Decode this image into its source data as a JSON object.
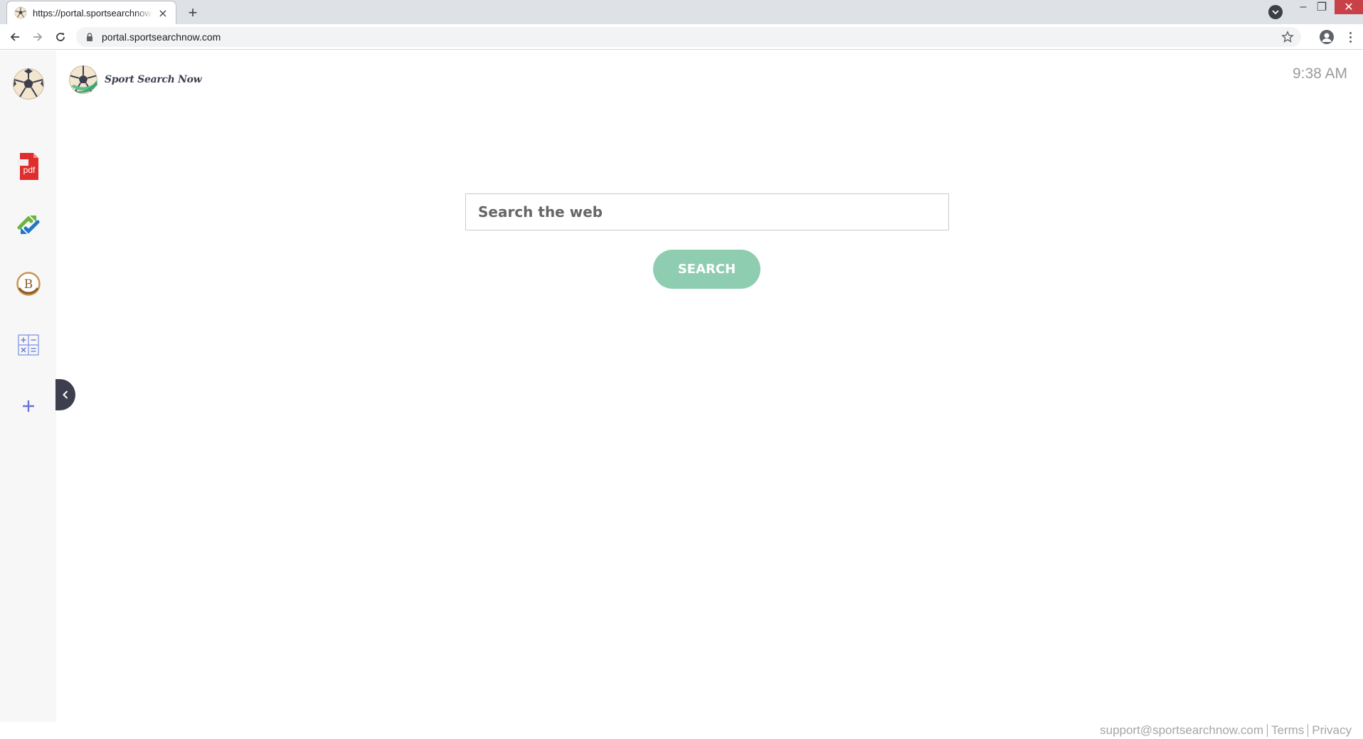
{
  "browser": {
    "tab": {
      "title": "https://portal.sportsearchnow.com",
      "close_glyph": "×"
    },
    "new_tab_glyph": "+",
    "url": "portal.sportsearchnow.com",
    "window": {
      "minimize_glyph": "–",
      "maximize_glyph": "❐",
      "close_glyph": "✕"
    }
  },
  "page": {
    "brand": {
      "name": "Sport Search Now",
      "logo_icon": "soccer-ball-icon"
    },
    "clock": "9:38 AM",
    "search": {
      "placeholder": "Search the web",
      "button_label": "SEARCH"
    },
    "sidebar": {
      "items": [
        {
          "name": "soccer-ball-icon"
        },
        {
          "name": "pdf-icon",
          "label": "pdf"
        },
        {
          "name": "converter-icon"
        },
        {
          "name": "bitcoin-icon",
          "label": "B"
        },
        {
          "name": "calculator-icon"
        },
        {
          "name": "add-icon"
        }
      ],
      "collapse_icon": "chevron-left-icon"
    },
    "footer": {
      "email": "support@sportsearchnow.com",
      "terms": "Terms",
      "privacy": "Privacy"
    }
  },
  "colors": {
    "accent_green": "#8ecdb0",
    "dark_navy": "#3d3f4f",
    "pdf_red": "#e02d2d",
    "calc_blue": "#5b6fd6",
    "bitcoin_brown": "#8a5a2b",
    "window_close_red": "#c94148"
  }
}
